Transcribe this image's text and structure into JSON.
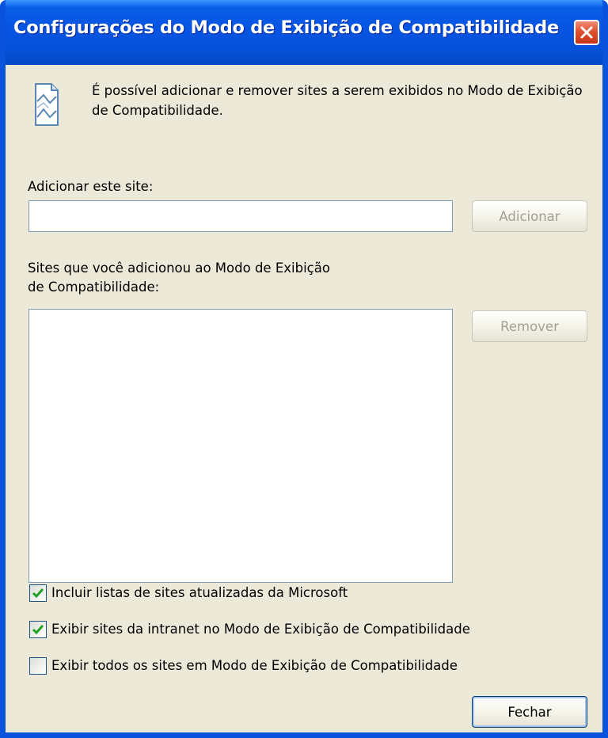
{
  "window": {
    "title": "Configurações do Modo de Exibição de Compatibilidade"
  },
  "info": {
    "icon": "globe-page-icon",
    "text": "É possível adicionar e remover sites a serem exibidos no Modo de Exibição de Compatibilidade."
  },
  "add_site": {
    "label": "Adicionar este site:",
    "value": "",
    "button_label": "Adicionar",
    "button_enabled": false
  },
  "sites_list": {
    "label": "Sites que você adicionou ao Modo de Exibição\nde Compatibilidade:",
    "items": [],
    "remove_button_label": "Remover",
    "remove_button_enabled": false
  },
  "options": [
    {
      "label": "Incluir listas de sites atualizadas da Microsoft",
      "checked": true
    },
    {
      "label": "Exibir sites da intranet no Modo de Exibição de Compatibilidade",
      "checked": true
    },
    {
      "label": "Exibir todos os sites em Modo de Exibição de Compatibilidade",
      "checked": false
    }
  ],
  "footer": {
    "close_button_label": "Fechar"
  },
  "colors": {
    "titlebar": "#0654E2",
    "dialog_bg": "#ECE9D8",
    "close_button": "#E0512E",
    "check_mark": "#21A121"
  }
}
